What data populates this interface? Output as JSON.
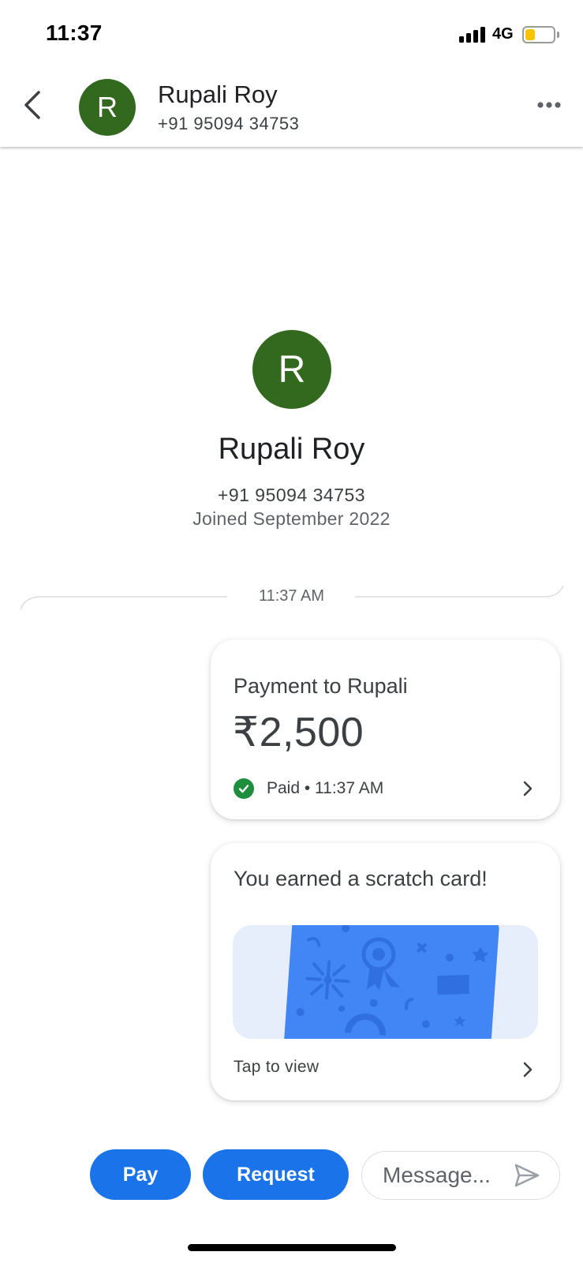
{
  "status_bar": {
    "time": "11:37",
    "network": "4G",
    "battery_level": 0.35,
    "battery_color": "#f6c500"
  },
  "header": {
    "back_icon": "chevron-left-icon",
    "avatar_initial": "R",
    "avatar_color": "#33691e",
    "name": "Rupali Roy",
    "phone": "+91 95094 34753",
    "more_icon": "more-horizontal-icon"
  },
  "profile": {
    "avatar_initial": "R",
    "name": "Rupali Roy",
    "phone": "+91 95094 34753",
    "joined": "Joined September 2022"
  },
  "conversation": {
    "timestamp": "11:37 AM",
    "payment_card": {
      "title": "Payment to Rupali",
      "amount": "₹2,500",
      "status": "Paid • 11:37 AM",
      "status_icon": "check-circle-icon",
      "status_color": "#1e8e3e"
    },
    "scratch_card": {
      "title": "You earned a scratch card!",
      "action": "Tap to view",
      "card_color": "#4285f4"
    }
  },
  "actions": {
    "pay_label": "Pay",
    "request_label": "Request",
    "message_placeholder": "Message...",
    "accent_color": "#1a73e8"
  }
}
